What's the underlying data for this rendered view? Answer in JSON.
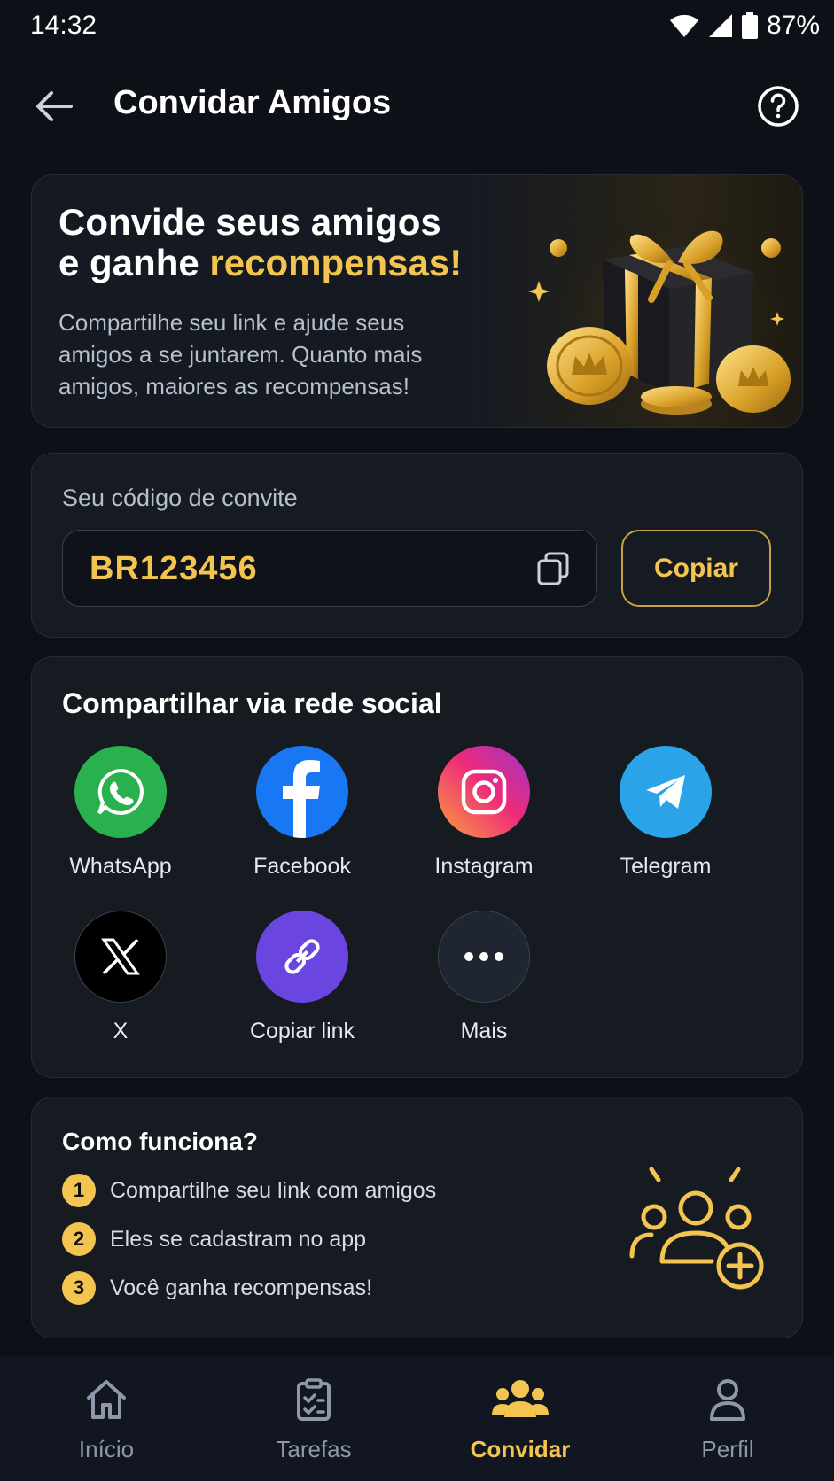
{
  "status_bar": {
    "time": "14:32",
    "battery": "87%"
  },
  "header": {
    "title": "Convidar Amigos"
  },
  "hero": {
    "title_line1": "Convide seus amigos",
    "title_line2_prefix": "e ganhe ",
    "title_highlight": "recompensas!",
    "description": "Compartilhe seu link e ajude seus amigos a se juntarem. Quanto mais amigos, maiores as recompensas!"
  },
  "invite": {
    "label": "Seu código de convite",
    "code": "BR123456",
    "copy_button": "Copiar"
  },
  "social": {
    "title": "Compartilhar via rede social",
    "items": [
      {
        "label": "WhatsApp",
        "icon": "whatsapp-icon",
        "color": "#29b14e"
      },
      {
        "label": "Facebook",
        "icon": "facebook-icon",
        "color": "#1877f2"
      },
      {
        "label": "Instagram",
        "icon": "instagram-icon",
        "color": "#e1306c"
      },
      {
        "label": "Telegram",
        "icon": "telegram-icon",
        "color": "#2aa3e8"
      },
      {
        "label": "X",
        "icon": "x-icon",
        "color": "#000000"
      },
      {
        "label": "Copiar link",
        "icon": "link-icon",
        "color": "#6a45e0"
      },
      {
        "label": "Mais",
        "icon": "more-icon",
        "color": "#202631"
      }
    ]
  },
  "how_it_works": {
    "title": "Como funciona?",
    "steps": [
      {
        "num": "1",
        "text": "Compartilhe seu link com amigos"
      },
      {
        "num": "2",
        "text": "Eles se cadastram no app"
      },
      {
        "num": "3",
        "text": "Você ganha recompensas!"
      }
    ]
  },
  "nav": {
    "items": [
      {
        "label": "Início",
        "icon": "home-icon"
      },
      {
        "label": "Tarefas",
        "icon": "tasks-icon"
      },
      {
        "label": "Convidar",
        "icon": "invite-icon",
        "active": true
      },
      {
        "label": "Perfil",
        "icon": "profile-icon"
      }
    ]
  },
  "colors": {
    "accent": "#f4c450",
    "background": "#0d1117",
    "card": "#161b22"
  }
}
